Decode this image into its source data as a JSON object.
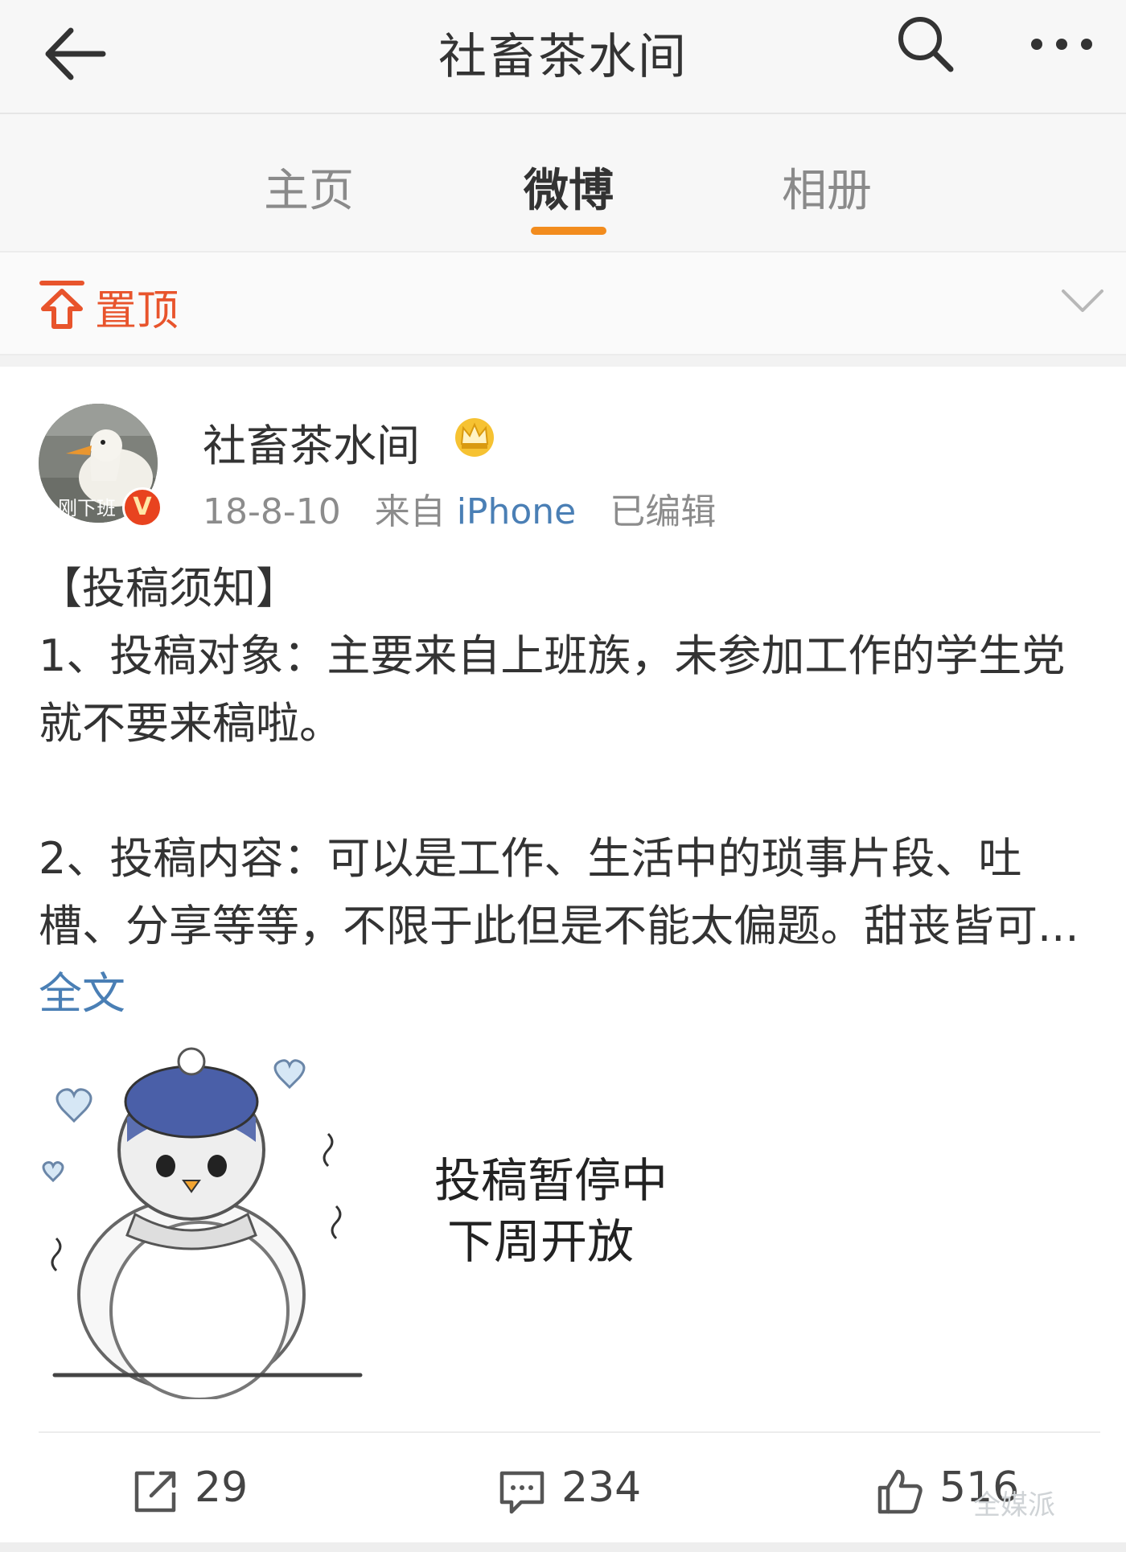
{
  "topbar": {
    "title": "社畜茶水间"
  },
  "tabs": [
    {
      "label": "主页"
    },
    {
      "label": "微博"
    },
    {
      "label": "相册"
    }
  ],
  "active_tab": "微博",
  "pinned": {
    "label": "置顶"
  },
  "post": {
    "author": "社畜茶水间",
    "avatar_text": "刚下班",
    "verified_badge": "V",
    "date": "18-8-10",
    "source_prefix": "来自",
    "source": "iPhone",
    "edited": "已编辑",
    "lines": [
      "【投稿须知】",
      "1、投稿对象：主要来自上班族，未参加工作的学生党就不要来稿啦。",
      "",
      "2、投稿内容：可以是工作、生活中的琐事片段、吐槽、分享等等，不限于此但是不能太偏题。甜丧皆可..."
    ],
    "full_text_link": "全文",
    "image": {
      "caption_line1": "投稿暂停中",
      "caption_line2": "下周开放"
    }
  },
  "actions": {
    "repost_count": "29",
    "comment_count": "234",
    "like_count": "516"
  },
  "watermark": "全媒派",
  "colors": {
    "accent_orange": "#f28c1e",
    "pin_red": "#e8542c",
    "link_blue": "#4a7fb5"
  },
  "icons": [
    "back-arrow-icon",
    "search-icon",
    "more-icon",
    "pin-top-icon",
    "chevron-down-icon",
    "crown-icon",
    "repost-icon",
    "comment-icon",
    "like-icon"
  ]
}
